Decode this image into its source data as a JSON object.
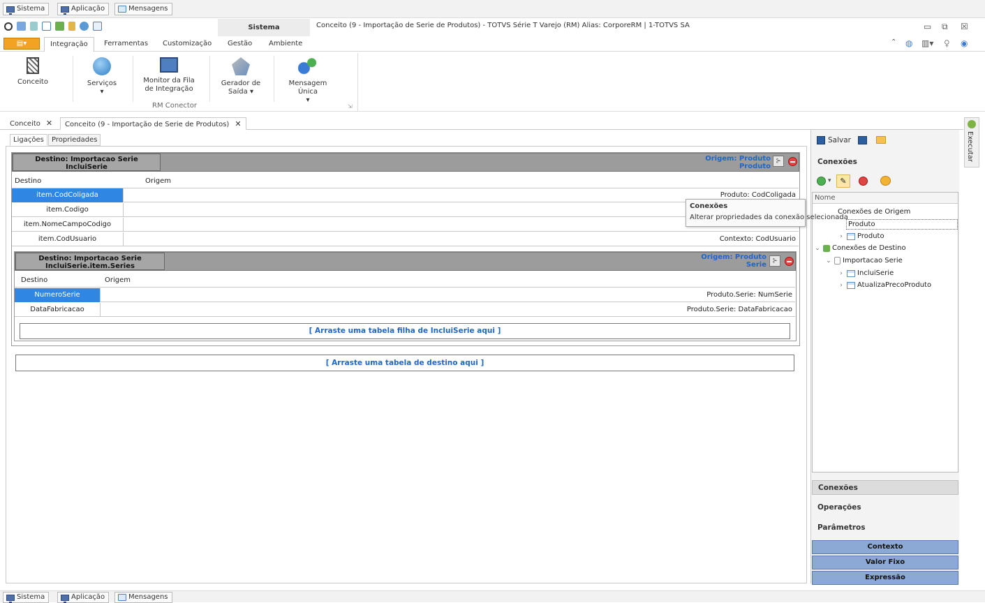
{
  "taskbar": {
    "sistema": "Sistema",
    "aplicacao": "Aplicação",
    "mensagens": "Mensagens"
  },
  "window": {
    "context_tab": "Sistema",
    "title": "Conceito (9 - Importação de Serie de Produtos) - TOTVS Série T Varejo (RM) Alias: CorporeRM | 1-TOTVS SA"
  },
  "menu": {
    "tabs": [
      "Integração",
      "Ferramentas",
      "Customização",
      "Gestão",
      "Ambiente"
    ]
  },
  "ribbon": {
    "group_label": "RM Conector",
    "buttons": [
      {
        "label": "Conceito",
        "icon": "grid-icon"
      },
      {
        "label": "Serviços",
        "icon": "globe-icon"
      },
      {
        "label": "Monitor da Fila de Integração",
        "icon": "monitor-icon"
      },
      {
        "label": "Gerador de Saída",
        "icon": "generator-icon"
      },
      {
        "label": "Mensagem Única",
        "icon": "message-icon"
      }
    ]
  },
  "doc_tabs": [
    "Conceito",
    "Conceito (9 - Importação de Serie de Produtos)"
  ],
  "sub_tabs": [
    "Ligações",
    "Propriedades"
  ],
  "panel1": {
    "dest": "Destino: Importacao Serie IncluiSerie",
    "orig": "Origem: Produto Produto",
    "col_dest": "Destino",
    "col_orig": "Origem",
    "rows": [
      {
        "dest": "item.CodColigada",
        "orig": "Produto: CodColigada"
      },
      {
        "dest": "item.Codigo",
        "orig": ""
      },
      {
        "dest": "item.NomeCampoCodigo",
        "orig": ""
      },
      {
        "dest": "item.CodUsuario",
        "orig": "Contexto: CodUsuario"
      }
    ]
  },
  "panel2": {
    "dest": "Destino: Importacao Serie IncluiSerie.item.Series",
    "orig": "Origem: Produto Serie",
    "col_dest": "Destino",
    "col_orig": "Origem",
    "rows": [
      {
        "dest": "NumeroSerie",
        "orig": "Produto.Serie: NumSerie"
      },
      {
        "dest": "DataFabricacao",
        "orig": "Produto.Serie: DataFabricacao"
      }
    ],
    "dropzone": "[ Arraste uma tabela filha de IncluiSerie aqui ]"
  },
  "dropzone_main": "[ Arraste uma tabela de destino aqui ]",
  "tooltip": {
    "title": "Conexões",
    "text": "Alterar propriedades da conexão selecionada"
  },
  "right": {
    "salvar": "Salvar",
    "section": "Conexões",
    "tree_header": "Nome",
    "tree": [
      "Conexões de Origem",
      "Produto",
      "Produto",
      "Conexões de Destino",
      "Importacao Serie",
      "IncluiSerie",
      "AtualizaPrecoProduto"
    ],
    "nav": [
      "Conexões",
      "Operações",
      "Parâmetros"
    ],
    "buttons": [
      "Contexto",
      "Valor Fixo",
      "Expressão"
    ]
  },
  "exec": "Executar"
}
